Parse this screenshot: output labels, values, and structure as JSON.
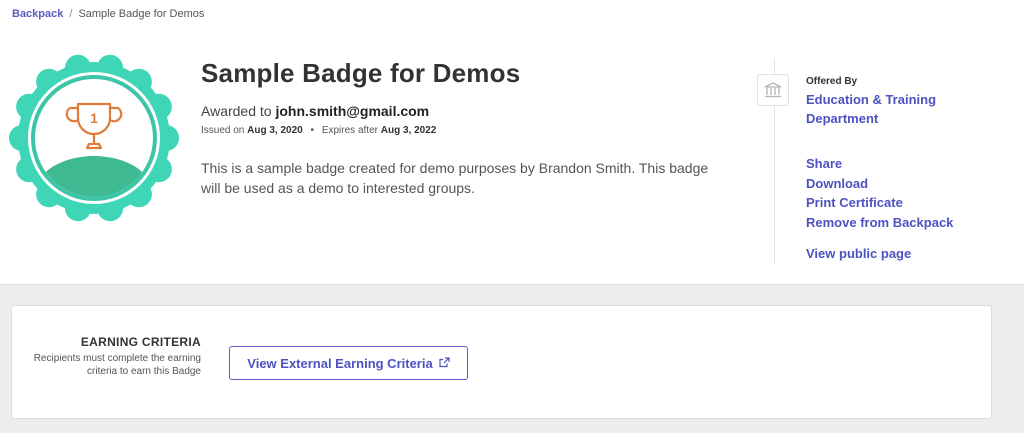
{
  "breadcrumb": {
    "root": "Backpack",
    "separator": "/",
    "current": "Sample Badge for Demos"
  },
  "badge": {
    "title": "Sample Badge for Demos",
    "awarded_prefix": "Awarded to",
    "recipient": "john.smith@gmail.com",
    "issued_label": "Issued on",
    "issued_date": "Aug 3, 2020",
    "expires_label": "Expires after",
    "expires_date": "Aug 3, 2022",
    "description": "This is a sample badge created for demo purposes by Brandon Smith. This badge will be used as a demo to interested groups.",
    "trophy_number": "1",
    "colors": {
      "ring": "#3fd6b8",
      "inner_ring": "#3cc5a7",
      "hill": "#3fb992",
      "trophy": "#e07b39"
    }
  },
  "issuer": {
    "icon": "institution-icon",
    "offered_label": "Offered By",
    "name": "Education & Training Department"
  },
  "actions": {
    "share": "Share",
    "download": "Download",
    "print": "Print Certificate",
    "remove": "Remove from Backpack",
    "view_public": "View public page"
  },
  "criteria": {
    "heading": "EARNING CRITERIA",
    "subtext": "Recipients must complete the earning criteria to earn this Badge",
    "button_label": "View External Earning Criteria",
    "button_icon": "external-link-icon"
  },
  "theme": {
    "link_color": "#4d52c1"
  }
}
